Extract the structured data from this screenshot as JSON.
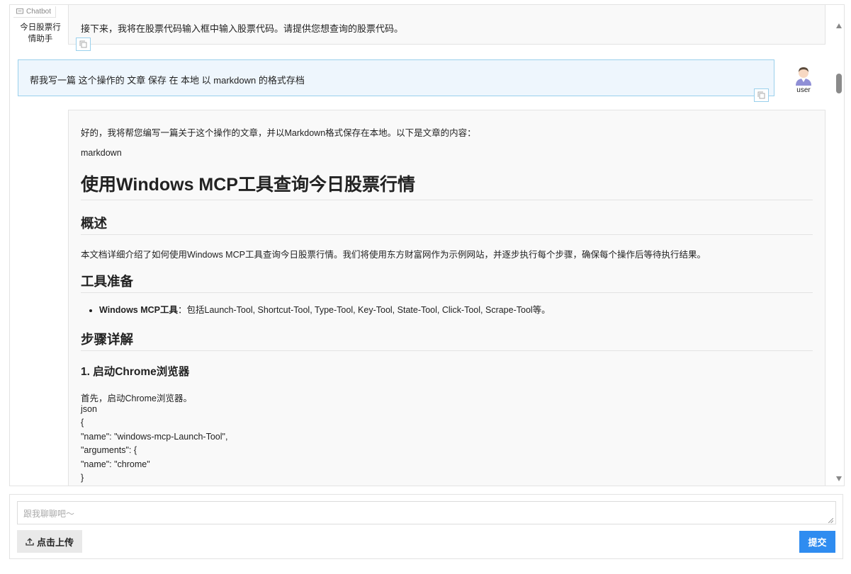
{
  "chatbot": {
    "label": "Chatbot",
    "bot_name": "今日股票行情助手",
    "messages": {
      "bot_prev": "接下来，我将在股票代码输入框中输入股票代码。请提供您想查询的股票代码。",
      "user": "帮我写一篇 这个操作的 文章 保存 在 本地 以 markdown 的格式存档",
      "user_name": "user"
    },
    "reply": {
      "intro": "好的，我将帮您编写一篇关于这个操作的文章，并以Markdown格式保存在本地。以下是文章的内容：",
      "lang": "markdown",
      "h1": "使用Windows MCP工具查询今日股票行情",
      "h2_overview": "概述",
      "overview_text": "本文档详细介绍了如何使用Windows MCP工具查询今日股票行情。我们将使用东方财富网作为示例网站，并逐步执行每个步骤，确保每个操作后等待执行结果。",
      "h2_tools": "工具准备",
      "tools_bold": "Windows MCP工具",
      "tools_text": "：包括Launch-Tool, Shortcut-Tool, Type-Tool, Key-Tool, State-Tool, Click-Tool, Scrape-Tool等。",
      "h2_steps": "步骤详解",
      "h3_step1": "1. 启动Chrome浏览器",
      "step1_text": "首先，启动Chrome浏览器。",
      "code_lines": [
        "json",
        "{",
        "\"name\": \"windows-mcp-Launch-Tool\",",
        "\"arguments\": {",
        "\"name\": \"chrome\"",
        "}"
      ]
    }
  },
  "composer": {
    "placeholder": "跟我聊聊吧～",
    "upload_label": "点击上传",
    "submit_label": "提交"
  }
}
